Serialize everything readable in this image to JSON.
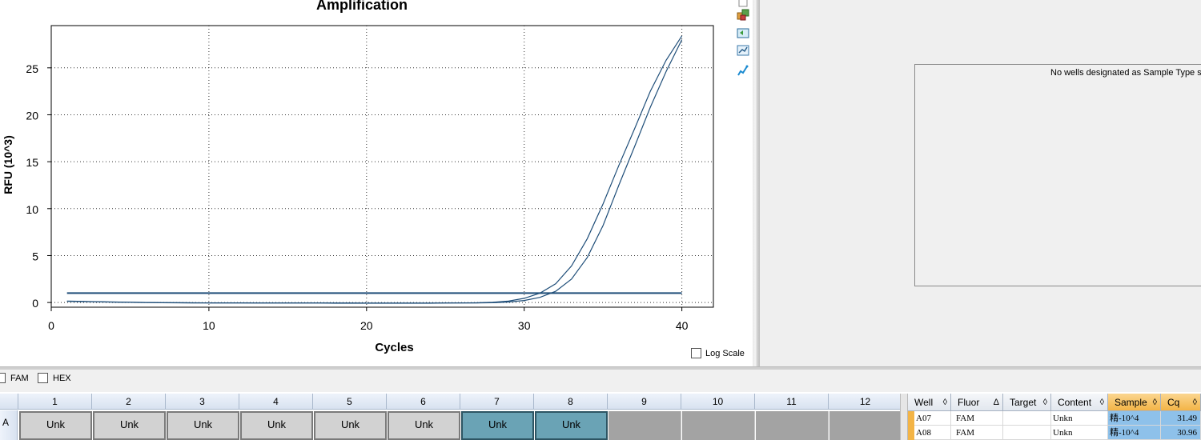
{
  "chart_data": {
    "type": "line",
    "title": "Amplification",
    "xlabel": "Cycles",
    "ylabel": "RFU (10^3)",
    "xlim": [
      0,
      42
    ],
    "ylim": [
      -0.5,
      29.5
    ],
    "xticks": [
      0,
      10,
      20,
      30,
      40
    ],
    "yticks": [
      0,
      5,
      10,
      15,
      20,
      25
    ],
    "grid": true,
    "threshold": 1.0,
    "series": [
      {
        "x": [
          1,
          2,
          3,
          4,
          5,
          6,
          7,
          8,
          9,
          10,
          11,
          12,
          13,
          14,
          15,
          16,
          17,
          18,
          19,
          20,
          21,
          22,
          23,
          24,
          25,
          26,
          27,
          28,
          29,
          30,
          31,
          32,
          33,
          34,
          35,
          36,
          37,
          38,
          39,
          40
        ],
        "y": [
          0.15,
          0.12,
          0.08,
          0.05,
          0.02,
          0.0,
          -0.02,
          -0.03,
          -0.04,
          -0.05,
          -0.05,
          -0.05,
          -0.06,
          -0.06,
          -0.06,
          -0.06,
          -0.06,
          -0.07,
          -0.07,
          -0.07,
          -0.07,
          -0.07,
          -0.07,
          -0.07,
          -0.06,
          -0.05,
          -0.03,
          0.02,
          0.15,
          0.45,
          1.0,
          2.0,
          3.9,
          6.8,
          10.5,
          14.6,
          18.5,
          22.5,
          25.8,
          28.4
        ]
      },
      {
        "x": [
          1,
          2,
          3,
          4,
          5,
          6,
          7,
          8,
          9,
          10,
          11,
          12,
          13,
          14,
          15,
          16,
          17,
          18,
          19,
          20,
          21,
          22,
          23,
          24,
          25,
          26,
          27,
          28,
          29,
          30,
          31,
          32,
          33,
          34,
          35,
          36,
          37,
          38,
          39,
          40
        ],
        "y": [
          0.12,
          0.1,
          0.07,
          0.04,
          0.02,
          0.0,
          -0.01,
          -0.02,
          -0.03,
          -0.04,
          -0.04,
          -0.04,
          -0.05,
          -0.05,
          -0.05,
          -0.05,
          -0.05,
          -0.05,
          -0.05,
          -0.06,
          -0.06,
          -0.06,
          -0.06,
          -0.06,
          -0.05,
          -0.05,
          -0.04,
          -0.02,
          0.05,
          0.22,
          0.55,
          1.2,
          2.5,
          4.8,
          8.2,
          12.5,
          16.6,
          20.8,
          24.6,
          28.0
        ]
      }
    ],
    "line_color": "#1f4e79"
  },
  "toolbar": {
    "icons": [
      "copy-icon",
      "export-icon",
      "zoom-icon",
      "chart-settings-icon"
    ]
  },
  "log_scale_label": "Log Scale",
  "sample_panel": {
    "message": "No wells designated as Sample Type sta"
  },
  "fluor_bar": {
    "items": [
      "FAM",
      "HEX"
    ]
  },
  "plate": {
    "columns": [
      "1",
      "2",
      "3",
      "4",
      "5",
      "6",
      "7",
      "8",
      "9",
      "10",
      "11",
      "12"
    ],
    "row_label": "A",
    "wells": [
      "Unk",
      "Unk",
      "Unk",
      "Unk",
      "Unk",
      "Unk",
      "Unk",
      "Unk",
      "",
      "",
      "",
      ""
    ]
  },
  "table": {
    "headers": [
      "Well",
      "Fluor",
      "Target",
      "Content",
      "Sample",
      "Cq"
    ],
    "rows": [
      {
        "well": "A07",
        "fluor": "FAM",
        "target": "",
        "content": "Unkn",
        "sample": "精-10^4",
        "cq": "31.49"
      },
      {
        "well": "A08",
        "fluor": "FAM",
        "target": "",
        "content": "Unkn",
        "sample": "精-10^4",
        "cq": "30.96"
      }
    ]
  }
}
